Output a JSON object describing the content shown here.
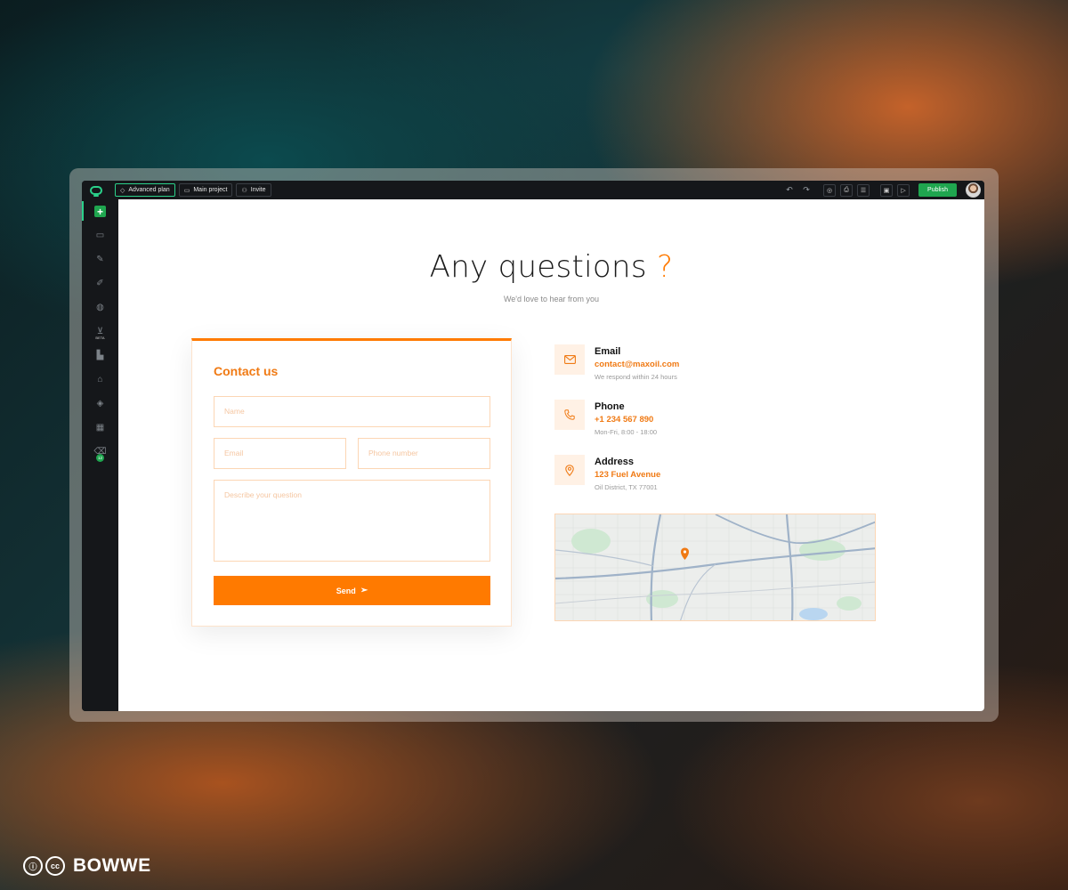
{
  "toolbar": {
    "plan_label": "Advanced plan",
    "project_label": "Main project",
    "invite_label": "Invite",
    "publish_label": "Publish"
  },
  "sidebar": {
    "beta_label": "BETA",
    "badge_count": "12"
  },
  "page": {
    "title_main": "Any questions",
    "title_mark": "?",
    "subtitle": "We'd love to hear from you"
  },
  "form": {
    "title": "Contact us",
    "name_placeholder": "Name",
    "email_placeholder": "Email",
    "phone_placeholder": "Phone number",
    "question_placeholder": "Describe your question",
    "send_label": "Send"
  },
  "contact": {
    "email": {
      "label": "Email",
      "value": "contact@maxoil.com",
      "note": "We respond within 24 hours"
    },
    "phone": {
      "label": "Phone",
      "value": "+1 234 567 890",
      "note": "Mon-Fri, 8:00 - 18:00"
    },
    "address": {
      "label": "Address",
      "value": "123 Fuel Avenue",
      "note": "Oil District, TX 77001"
    }
  },
  "footer": {
    "cc_label": "cc",
    "brand": "BOWWE"
  },
  "colors": {
    "accent": "#ff7a00",
    "publish": "#1fa64f",
    "editor_bg": "#15171a"
  }
}
